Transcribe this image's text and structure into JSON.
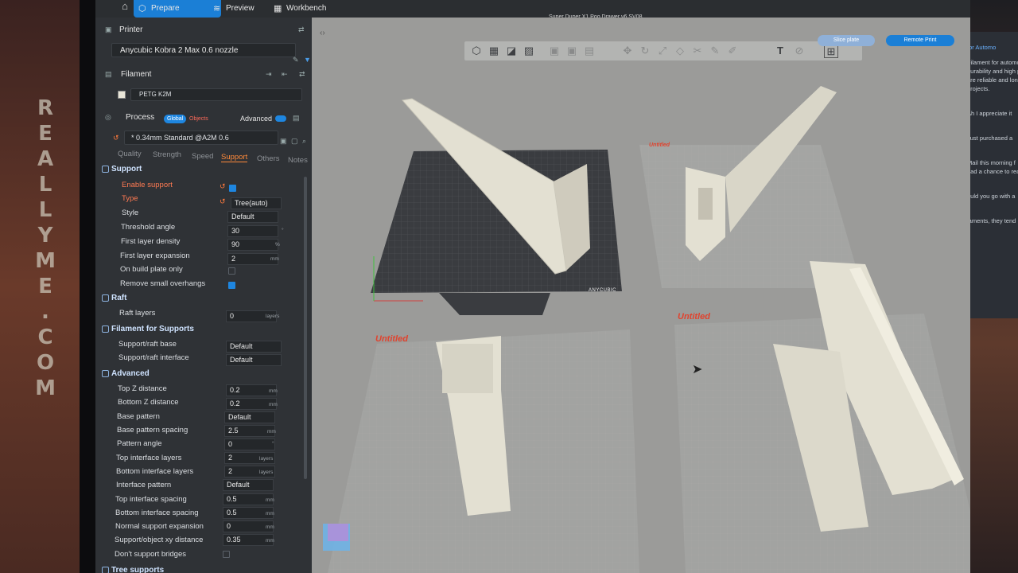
{
  "wall_text": "REALLYME.COM",
  "app": {
    "window_title": "Super Duper X1 Poo Drawer v6 SV08",
    "tabs": [
      {
        "label": "Prepare",
        "icon": "cube-icon"
      },
      {
        "label": "Preview",
        "icon": "layers-icon"
      },
      {
        "label": "Workbench",
        "icon": "grid-icon"
      }
    ],
    "window_controls": [
      "–",
      "□",
      "×"
    ]
  },
  "printer": {
    "header": "Printer",
    "name": "Anycubic Kobra 2 Max 0.6 nozzle"
  },
  "filament": {
    "header": "Filament",
    "name": "PETG K2M"
  },
  "process": {
    "header": "Process",
    "toggle_global": "Global",
    "toggle_objects": "Objects",
    "advanced_label": "Advanced",
    "profile": "* 0.34mm Standard @A2M 0.6",
    "tabs": [
      "Quality",
      "Strength",
      "Speed",
      "Support",
      "Others",
      "Notes"
    ],
    "active_tab": "Support"
  },
  "groups": {
    "support": "Support",
    "raft": "Raft",
    "filament_supports": "Filament for Supports",
    "advanced": "Advanced",
    "tree": "Tree supports"
  },
  "settings": {
    "enable_support": {
      "label": "Enable support",
      "checked": true
    },
    "type": {
      "label": "Type",
      "value": "Tree(auto)"
    },
    "style": {
      "label": "Style",
      "value": "Default"
    },
    "threshold_angle": {
      "label": "Threshold angle",
      "value": "30",
      "unit": "°"
    },
    "first_layer_density": {
      "label": "First layer density",
      "value": "90",
      "unit": "%"
    },
    "first_layer_expansion": {
      "label": "First layer expansion",
      "value": "2",
      "unit": "mm"
    },
    "on_build_plate_only": {
      "label": "On build plate only",
      "checked": false
    },
    "remove_small_overhangs": {
      "label": "Remove small overhangs",
      "checked": true
    },
    "raft_layers": {
      "label": "Raft layers",
      "value": "0",
      "unit": "layers"
    },
    "support_raft_base": {
      "label": "Support/raft base",
      "value": "Default"
    },
    "support_raft_interface": {
      "label": "Support/raft interface",
      "value": "Default"
    },
    "top_z_distance": {
      "label": "Top Z distance",
      "value": "0.2",
      "unit": "mm"
    },
    "bottom_z_distance": {
      "label": "Bottom Z distance",
      "value": "0.2",
      "unit": "mm"
    },
    "base_pattern": {
      "label": "Base pattern",
      "value": "Default"
    },
    "base_pattern_spacing": {
      "label": "Base pattern spacing",
      "value": "2.5",
      "unit": "mm"
    },
    "pattern_angle": {
      "label": "Pattern angle",
      "value": "0",
      "unit": "°"
    },
    "top_interface_layers": {
      "label": "Top interface layers",
      "value": "2",
      "unit": "layers"
    },
    "bottom_interface_layers": {
      "label": "Bottom interface layers",
      "value": "2",
      "unit": "layers"
    },
    "interface_pattern": {
      "label": "Interface pattern",
      "value": "Default"
    },
    "top_interface_spacing": {
      "label": "Top interface spacing",
      "value": "0.5",
      "unit": "mm"
    },
    "bottom_interface_spacing": {
      "label": "Bottom interface spacing",
      "value": "0.5",
      "unit": "mm"
    },
    "normal_support_expansion": {
      "label": "Normal support expansion",
      "value": "0",
      "unit": "mm"
    },
    "support_object_xy_distance": {
      "label": "Support/object xy distance",
      "value": "0.35",
      "unit": "mm"
    },
    "dont_support_bridges": {
      "label": "Don't support bridges",
      "checked": false
    }
  },
  "viewport": {
    "plate_labels": [
      "Untitled",
      "Untitled",
      "Untitled"
    ],
    "plate_brand": "ANYCUBIC",
    "slice_button": "Slice plate",
    "export_button": "Remote Print"
  },
  "side_window": {
    "lines": [
      "Filament for automo",
      "durability and high p",
      "are reliable and lon",
      "projects.",
      "Ah I appreciate it",
      "Just purchased a",
      "Mail this morning f",
      "had a chance to rea",
      "ould you go with a",
      "laments, they tend"
    ],
    "header": "for Automo"
  },
  "colors": {
    "accent": "#1b7fd6",
    "support_tab": "#ff8a3a",
    "plate_label": "#e0432e",
    "model": "#e3e0d2"
  }
}
